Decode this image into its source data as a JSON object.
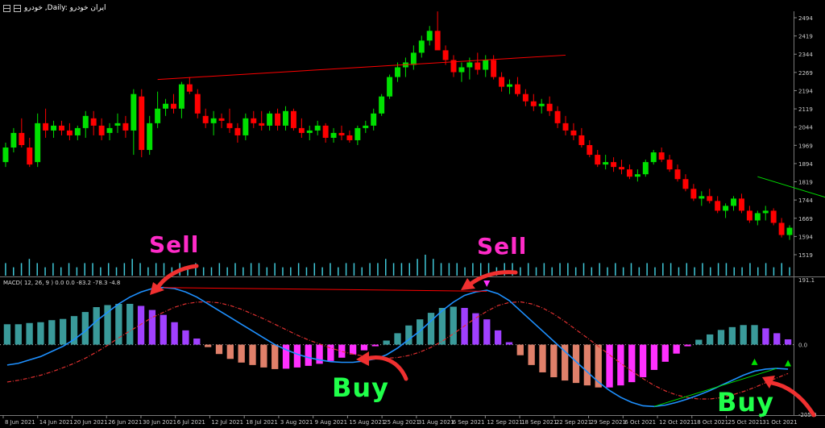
{
  "window": {
    "title": "خودرو ,Daily: ایران خودرو"
  },
  "indicator_label": "MACD( 12, 26, 9 ) 0.0 0.0 -83.2 -78.3 -4.8",
  "annotations": {
    "sell_left": "Sell",
    "sell_right": "Sell",
    "buy_left": "Buy",
    "buy_right": "Buy"
  },
  "colors": {
    "background": "#000000",
    "bull_candle": "#00e000",
    "bear_candle": "#ff0000",
    "volume": "#40c8d8",
    "macd_line": "#1e90ff",
    "signal_line": "#e03030",
    "sell_text": "#ff2bc8",
    "buy_text": "#20ff4a",
    "arrow": "#f03030",
    "hist_bull": "#3a9a9a",
    "hist_bear": "#e0806a",
    "hist_purple": "#a040ff",
    "hist_magenta": "#ff30ff"
  },
  "chart_data": [
    {
      "type": "candlestick",
      "price_ticks": [
        "2494",
        "2419",
        "2344",
        "2269",
        "2194",
        "2119",
        "2044",
        "1969",
        "1894",
        "1819",
        "1744",
        "1669",
        "1594",
        "1519"
      ],
      "ylim": [
        1519,
        2494
      ],
      "dates": [
        "8 Jun 2021",
        "14 Jun 2021",
        "20 Jun 2021",
        "26 Jun 2021",
        "30 Jun 2021",
        "6 Jul 2021",
        "12 Jul 2021",
        "18 Jul 2021",
        "3 Aug 2021",
        "9 Aug 2021",
        "15 Aug 2021",
        "25 Aug 2021",
        "31 Aug 2021",
        "6 Sep 2021",
        "12 Sep 2021",
        "18 Sep 2021",
        "22 Sep 2021",
        "29 Sep 2021",
        "6 Oct 2021",
        "12 Oct 2021",
        "18 Oct 2021",
        "25 Oct 2021",
        "31 Oct 2021"
      ],
      "ohlc": [
        [
          1900,
          1980,
          1880,
          1960
        ],
        [
          1960,
          2040,
          1940,
          2020
        ],
        [
          2020,
          2080,
          1960,
          1970
        ],
        [
          1960,
          2000,
          1880,
          1890
        ],
        [
          1900,
          2100,
          1880,
          2060
        ],
        [
          2060,
          2120,
          2000,
          2030
        ],
        [
          2030,
          2070,
          2000,
          2050
        ],
        [
          2050,
          2070,
          2010,
          2030
        ],
        [
          2030,
          2060,
          1990,
          2010
        ],
        [
          2010,
          2050,
          1990,
          2040
        ],
        [
          2040,
          2110,
          2000,
          2090
        ],
        [
          2080,
          2110,
          2010,
          2050
        ],
        [
          2050,
          2080,
          1990,
          2010
        ],
        [
          2020,
          2060,
          1990,
          2040
        ],
        [
          2050,
          2100,
          2020,
          2060
        ],
        [
          2060,
          2090,
          2000,
          2030
        ],
        [
          2030,
          2200,
          1930,
          2180
        ],
        [
          2170,
          2200,
          1920,
          1950
        ],
        [
          1950,
          2090,
          1930,
          2060
        ],
        [
          2060,
          2190,
          2040,
          2120
        ],
        [
          2120,
          2160,
          2090,
          2140
        ],
        [
          2140,
          2180,
          2100,
          2120
        ],
        [
          2120,
          2230,
          2080,
          2220
        ],
        [
          2220,
          2250,
          2180,
          2190
        ],
        [
          2180,
          2200,
          2080,
          2100
        ],
        [
          2090,
          2120,
          2040,
          2060
        ],
        [
          2060,
          2110,
          2010,
          2080
        ],
        [
          2080,
          2100,
          2040,
          2070
        ],
        [
          2060,
          2120,
          2020,
          2040
        ],
        [
          2040,
          2060,
          1980,
          2010
        ],
        [
          2010,
          2100,
          1990,
          2080
        ],
        [
          2080,
          2110,
          2040,
          2060
        ],
        [
          2060,
          2110,
          2030,
          2050
        ],
        [
          2050,
          2110,
          2030,
          2100
        ],
        [
          2100,
          2120,
          2030,
          2050
        ],
        [
          2050,
          2130,
          2030,
          2110
        ],
        [
          2110,
          2120,
          2030,
          2040
        ],
        [
          2040,
          2080,
          2000,
          2020
        ],
        [
          2020,
          2050,
          1990,
          2030
        ],
        [
          2030,
          2070,
          2010,
          2050
        ],
        [
          2050,
          2060,
          1980,
          2000
        ],
        [
          2000,
          2040,
          1980,
          2020
        ],
        [
          2020,
          2050,
          1990,
          2010
        ],
        [
          2010,
          2030,
          1980,
          1990
        ],
        [
          1990,
          2050,
          1970,
          2040
        ],
        [
          2040,
          2070,
          2020,
          2050
        ],
        [
          2050,
          2120,
          2030,
          2100
        ],
        [
          2100,
          2180,
          2090,
          2170
        ],
        [
          2170,
          2260,
          2160,
          2250
        ],
        [
          2250,
          2310,
          2230,
          2290
        ],
        [
          2290,
          2330,
          2250,
          2310
        ],
        [
          2300,
          2380,
          2280,
          2350
        ],
        [
          2350,
          2420,
          2330,
          2400
        ],
        [
          2400,
          2460,
          2380,
          2440
        ],
        [
          2440,
          2520,
          2420,
          2360
        ],
        [
          2360,
          2380,
          2300,
          2320
        ],
        [
          2320,
          2340,
          2250,
          2270
        ],
        [
          2270,
          2310,
          2230,
          2290
        ],
        [
          2290,
          2330,
          2240,
          2310
        ],
        [
          2310,
          2350,
          2260,
          2280
        ],
        [
          2280,
          2340,
          2250,
          2320
        ],
        [
          2320,
          2340,
          2240,
          2250
        ],
        [
          2250,
          2270,
          2190,
          2210
        ],
        [
          2210,
          2240,
          2180,
          2220
        ],
        [
          2220,
          2250,
          2170,
          2180
        ],
        [
          2180,
          2200,
          2130,
          2150
        ],
        [
          2150,
          2180,
          2110,
          2130
        ],
        [
          2130,
          2160,
          2100,
          2140
        ],
        [
          2140,
          2170,
          2090,
          2110
        ],
        [
          2110,
          2130,
          2040,
          2060
        ],
        [
          2060,
          2090,
          2010,
          2030
        ],
        [
          2030,
          2060,
          1990,
          2010
        ],
        [
          2010,
          2040,
          1960,
          1970
        ],
        [
          1970,
          1990,
          1920,
          1930
        ],
        [
          1930,
          1950,
          1880,
          1890
        ],
        [
          1890,
          1930,
          1870,
          1900
        ],
        [
          1900,
          1920,
          1860,
          1880
        ],
        [
          1880,
          1910,
          1850,
          1870
        ],
        [
          1870,
          1890,
          1830,
          1840
        ],
        [
          1840,
          1870,
          1820,
          1850
        ],
        [
          1850,
          1910,
          1840,
          1900
        ],
        [
          1900,
          1950,
          1890,
          1940
        ],
        [
          1940,
          1960,
          1900,
          1910
        ],
        [
          1910,
          1930,
          1860,
          1870
        ],
        [
          1870,
          1890,
          1820,
          1830
        ],
        [
          1830,
          1850,
          1780,
          1790
        ],
        [
          1790,
          1810,
          1740,
          1750
        ],
        [
          1750,
          1780,
          1720,
          1760
        ],
        [
          1760,
          1790,
          1730,
          1740
        ],
        [
          1740,
          1760,
          1690,
          1700
        ],
        [
          1700,
          1730,
          1670,
          1720
        ],
        [
          1720,
          1760,
          1700,
          1750
        ],
        [
          1750,
          1770,
          1690,
          1700
        ],
        [
          1700,
          1720,
          1650,
          1660
        ],
        [
          1660,
          1700,
          1640,
          1690
        ],
        [
          1690,
          1720,
          1660,
          1700
        ],
        [
          1700,
          1710,
          1640,
          1650
        ],
        [
          1650,
          1670,
          1590,
          1600
        ],
        [
          1600,
          1640,
          1580,
          1630
        ]
      ],
      "trendlines": [
        {
          "from": [
            19,
            2240
          ],
          "to": [
            70,
            2340
          ],
          "color": "#ff0000"
        },
        {
          "from": [
            94,
            1840
          ],
          "to": [
            119,
            1590
          ],
          "color": "#00e000"
        }
      ]
    },
    {
      "type": "bar",
      "name": "volume",
      "values": [
        3,
        2,
        3,
        4,
        3,
        2,
        3,
        2,
        3,
        2,
        3,
        3,
        2,
        3,
        2,
        3,
        4,
        3,
        2,
        3,
        3,
        2,
        3,
        2,
        3,
        2,
        2,
        3,
        2,
        3,
        2,
        3,
        3,
        2,
        3,
        2,
        2,
        3,
        2,
        3,
        2,
        3,
        2,
        3,
        3,
        2,
        3,
        3,
        4,
        3,
        3,
        3,
        4,
        5,
        4,
        3,
        3,
        3,
        2,
        3,
        3,
        3,
        2,
        3,
        3,
        2,
        3,
        2,
        3,
        2,
        3,
        3,
        2,
        3,
        2,
        3,
        2,
        3,
        2,
        3,
        2,
        3,
        2,
        3,
        3,
        2,
        3,
        2,
        3,
        2,
        3,
        3,
        2,
        2,
        3,
        2,
        3,
        2,
        3,
        2
      ]
    },
    {
      "type": "line",
      "name": "MACD",
      "yticks": [
        "191.1",
        "0.0",
        "-205.0"
      ],
      "ylim": [
        -205,
        191.1
      ],
      "macd": [
        -60,
        -55,
        -45,
        -35,
        -20,
        -5,
        15,
        40,
        70,
        95,
        120,
        140,
        155,
        165,
        168,
        165,
        155,
        140,
        120,
        100,
        80,
        60,
        40,
        20,
        0,
        -15,
        -28,
        -38,
        -45,
        -50,
        -52,
        -52,
        -48,
        -42,
        -30,
        -10,
        15,
        40,
        70,
        100,
        125,
        145,
        155,
        160,
        150,
        130,
        100,
        70,
        40,
        10,
        -20,
        -50,
        -80,
        -110,
        -135,
        -155,
        -170,
        -180,
        -182,
        -178,
        -170,
        -160,
        -148,
        -135,
        -120,
        -105,
        -90,
        -78,
        -72,
        -70,
        -72
      ],
      "signal": [
        -110,
        -105,
        -98,
        -90,
        -80,
        -68,
        -55,
        -40,
        -22,
        -2,
        20,
        40,
        60,
        80,
        95,
        110,
        120,
        125,
        126,
        123,
        115,
        104,
        90,
        76,
        60,
        44,
        28,
        14,
        2,
        -10,
        -20,
        -28,
        -34,
        -38,
        -40,
        -38,
        -32,
        -22,
        -8,
        10,
        32,
        55,
        78,
        98,
        115,
        124,
        126,
        120,
        108,
        90,
        68,
        44,
        20,
        -5,
        -30,
        -55,
        -78,
        -100,
        -120,
        -136,
        -148,
        -156,
        -160,
        -160,
        -156,
        -148,
        -138,
        -126,
        -112,
        -98,
        -85
      ]
    }
  ]
}
